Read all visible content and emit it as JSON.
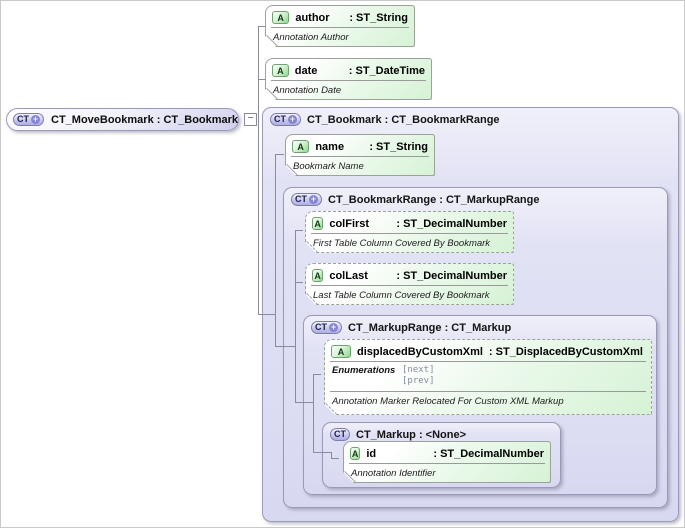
{
  "badges": {
    "ct": "CT",
    "a": "A",
    "plus": "+",
    "minus": "−"
  },
  "root_node": {
    "label": "CT_MoveBookmark : CT_Bookmark"
  },
  "containers": {
    "ct_bookmark": {
      "label": "CT_Bookmark : CT_BookmarkRange"
    },
    "ct_bookmarkrange": {
      "label": "CT_BookmarkRange : CT_MarkupRange"
    },
    "ct_markuprange": {
      "label": "CT_MarkupRange : CT_Markup"
    },
    "ct_markup": {
      "label": "CT_Markup : <None>"
    }
  },
  "attributes": {
    "author": {
      "name": "author",
      "type": ": ST_String",
      "desc": "Annotation Author"
    },
    "date": {
      "name": "date",
      "type": ": ST_DateTime",
      "desc": "Annotation Date"
    },
    "name": {
      "name": "name",
      "type": ": ST_String",
      "desc": "Bookmark Name"
    },
    "colFirst": {
      "name": "colFirst",
      "type": ": ST_DecimalNumber",
      "desc": "First Table Column Covered By Bookmark"
    },
    "colLast": {
      "name": "colLast",
      "type": ": ST_DecimalNumber",
      "desc": "Last Table Column Covered By Bookmark"
    },
    "displacedByCustomXml": {
      "name": "displacedByCustomXml",
      "type": ": ST_DisplacedByCustomXml",
      "enum_label": "Enumerations",
      "enum_values": [
        "[next]",
        "[prev]"
      ],
      "desc": "Annotation Marker Relocated For Custom XML Markup"
    },
    "id": {
      "name": "id",
      "type": ": ST_DecimalNumber",
      "desc": "Annotation Identifier"
    }
  },
  "colors": {
    "container_fill": "#dcdcf3",
    "attribute_fill": "#dcf4dc",
    "badge_accent": "#8585d2",
    "connector_line": "#8a8a9a"
  }
}
